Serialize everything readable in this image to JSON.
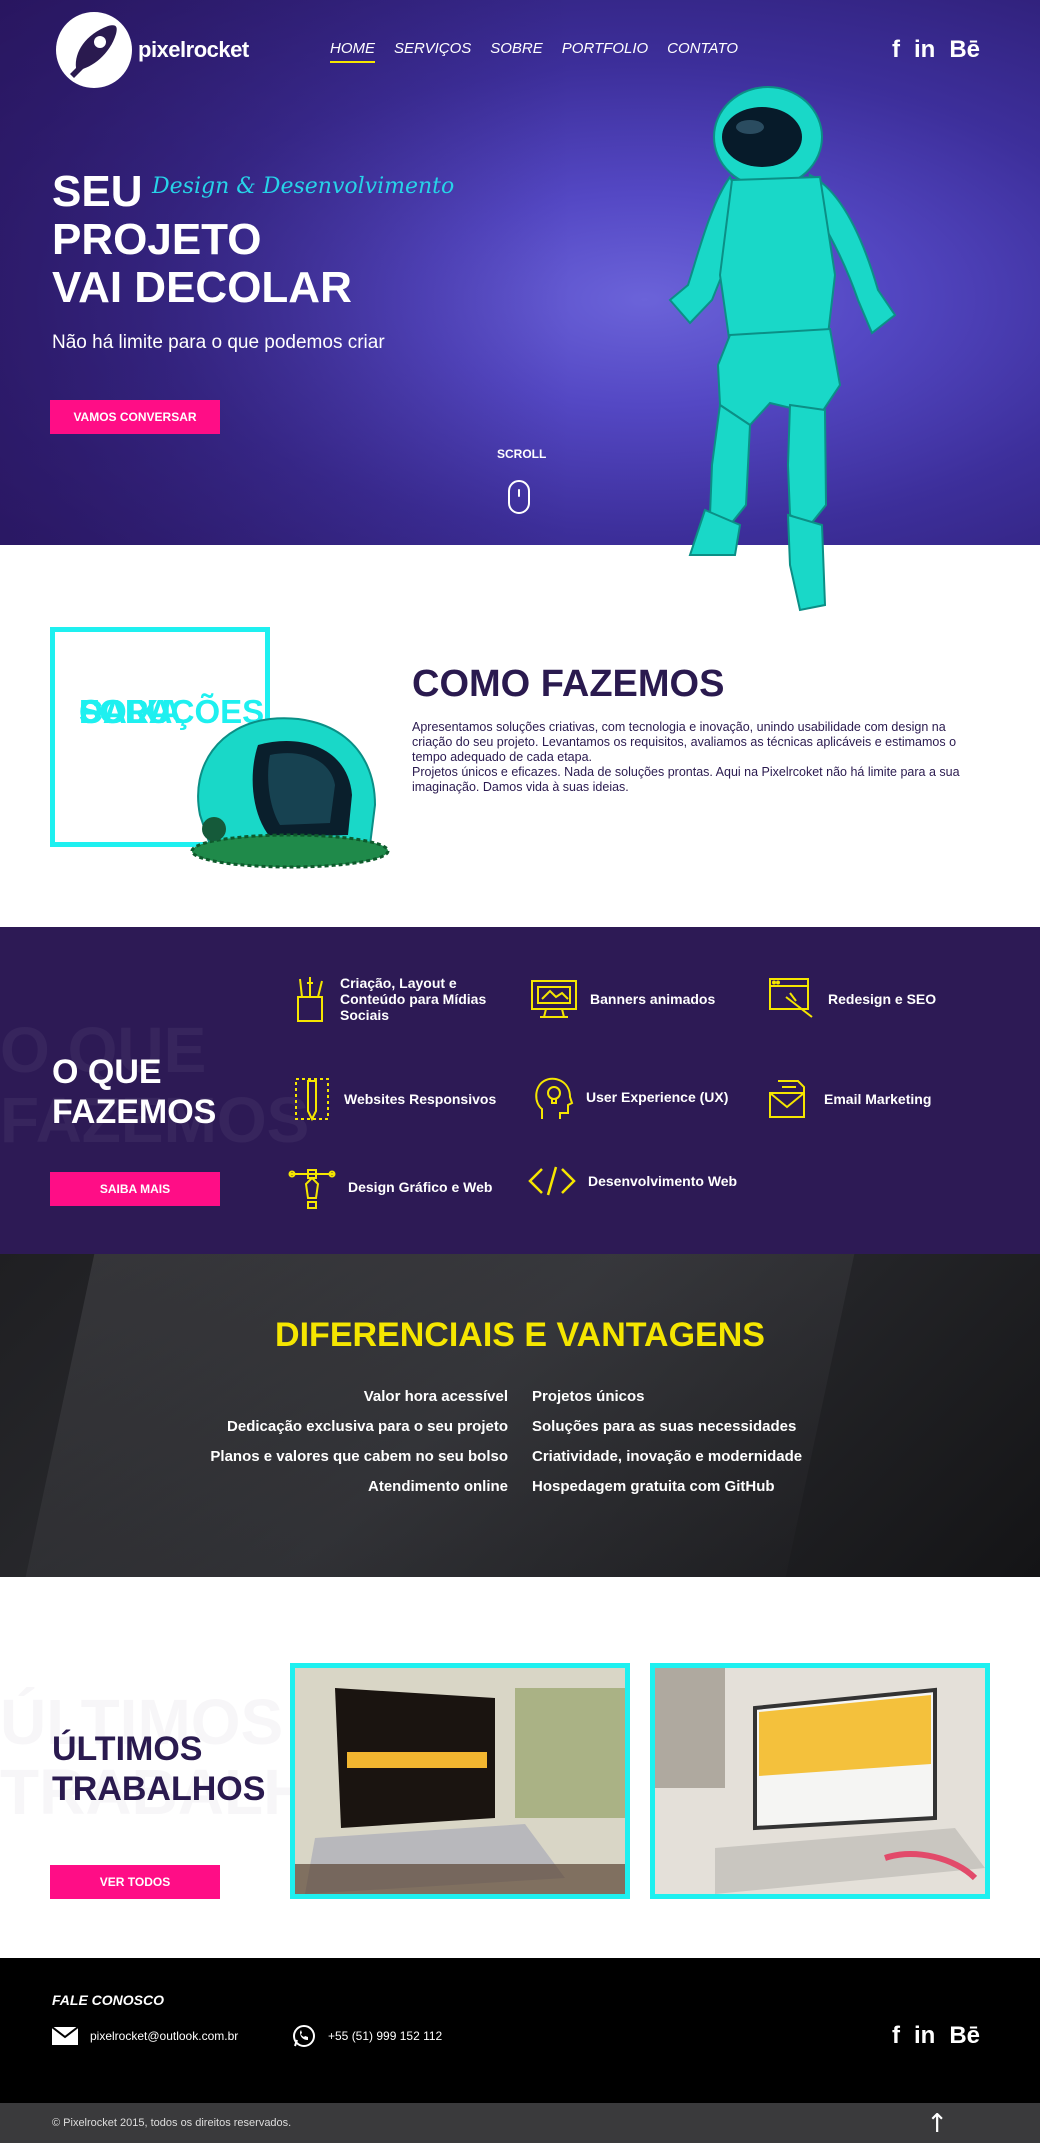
{
  "colors": {
    "accent_pink": "#ff0d86",
    "accent_cyan": "#1ef0f0",
    "accent_yellow": "#f5e600",
    "purple_dark": "#2d1a55"
  },
  "nav": {
    "logo_text": "pixelrocket",
    "items": [
      "HOME",
      "SERVIÇOS",
      "SOBRE",
      "PORTFOLIO",
      "CONTATO"
    ],
    "active": "HOME",
    "social": [
      "f",
      "in",
      "Bē"
    ]
  },
  "hero": {
    "title_lines": [
      "SEU",
      "PROJETO",
      "VAI DECOLAR"
    ],
    "script": "Design & Desenvolvimento",
    "subtitle": "Não há limite para o que podemos criar",
    "button": "VAMOS CONVERSAR",
    "scroll": "SCROLL"
  },
  "how": {
    "box_lines": [
      "SOLUÇÕES",
      "FORA",
      "DA",
      "CAIXA"
    ],
    "heading": "COMO FAZEMOS",
    "paragraphs": [
      "Apresentamos soluções criativas, com tecnologia e inovação, unindo usabilidade com design na criação do seu projeto. Levantamos os requisitos, avaliamos as técnicas aplicáveis e estimamos o tempo adequado de cada etapa.",
      "Projetos únicos e eficazes. Nada de soluções prontas. Aqui na Pixelrcoket não há limite para a sua imaginação. Damos vida à suas ideias."
    ]
  },
  "services": {
    "ghost": "O QUE FAZEMOS",
    "title_lines": [
      "O QUE",
      "FAZEMOS"
    ],
    "button": "SAIBA MAIS",
    "items": [
      {
        "label": "Criação, Layout e Conteúdo para Mídias Sociais",
        "icon": "brush-cup-icon"
      },
      {
        "label": "Banners animados",
        "icon": "banner-monitor-icon"
      },
      {
        "label": "Redesign e SEO",
        "icon": "redesign-browser-icon"
      },
      {
        "label": "Websites Responsivos",
        "icon": "pencil-ruler-icon"
      },
      {
        "label": "User Experience (UX)",
        "icon": "head-lightbulb-icon"
      },
      {
        "label": "Email Marketing",
        "icon": "email-document-icon"
      },
      {
        "label": "Design Gráfico e Web",
        "icon": "pen-tool-icon"
      },
      {
        "label": "Desenvolvimento Web",
        "icon": "code-brackets-icon"
      }
    ]
  },
  "diff": {
    "title": "DIFERENCIAIS E VANTAGENS",
    "left": [
      "Valor hora acessível",
      "Dedicação exclusiva para o seu projeto",
      "Planos e valores que cabem no seu bolso",
      "Atendimento online"
    ],
    "right": [
      "Projetos únicos",
      "Soluções para as suas necessidades",
      "Criatividade, inovação e modernidade",
      "Hospedagem gratuita com GitHub"
    ]
  },
  "works": {
    "ghost": "ÚLTIMOS TRABALHOS",
    "title_lines": [
      "ÚLTIMOS",
      "TRABALHOS"
    ],
    "button": "VER TODOS"
  },
  "footer": {
    "fale": "FALE CONOSCO",
    "email": "pixelrocket@outlook.com.br",
    "phone": "+55 (51) 999 152 112",
    "social": [
      "f",
      "in",
      "Bē"
    ],
    "copyright": "© Pixelrocket 2015, todos os direitos reservados.",
    "up_arrow": "↑"
  }
}
